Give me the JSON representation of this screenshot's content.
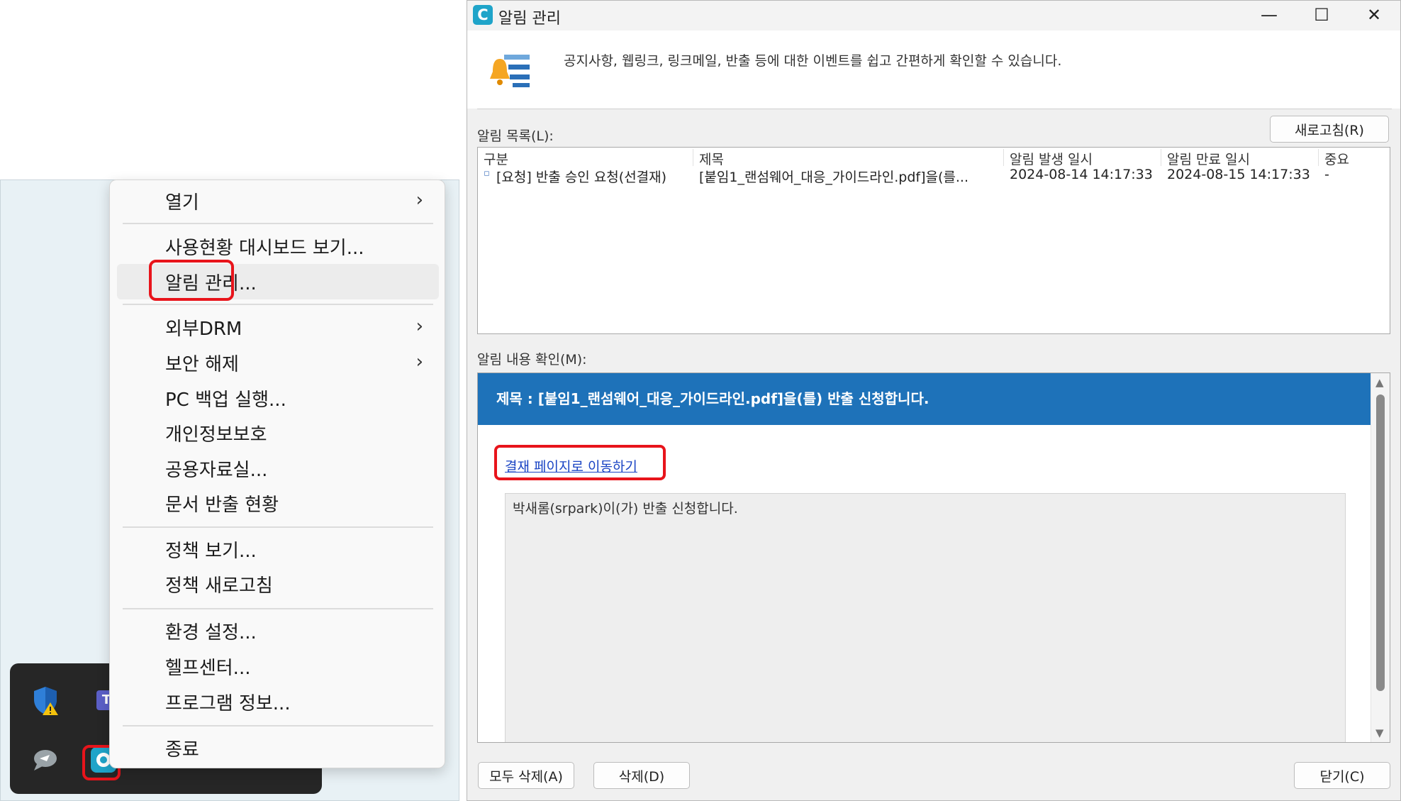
{
  "context_menu": {
    "items": [
      {
        "label": "열기"
      },
      {
        "label": "사용현황 대시보드 보기..."
      },
      {
        "label": "알림 관리..."
      },
      {
        "label": "외부DRM"
      },
      {
        "label": "보안 해제"
      },
      {
        "label": "PC 백업 실행..."
      },
      {
        "label": "개인정보보호"
      },
      {
        "label": "공용자료실..."
      },
      {
        "label": "문서 반출 현황"
      },
      {
        "label": "정책 보기..."
      },
      {
        "label": "정책 새로고침"
      },
      {
        "label": "환경 설정..."
      },
      {
        "label": "헬프센터..."
      },
      {
        "label": "프로그램 정보..."
      },
      {
        "label": "종료"
      }
    ]
  },
  "tray": {
    "teams_label": "T"
  },
  "window": {
    "title": "알림 관리",
    "app_icon_letter": "C",
    "controls": {
      "minimize": "—",
      "maximize": "☐",
      "close": "✕"
    },
    "description": "공지사항, 웹링크, 링크메일, 반출 등에 대한 이벤트를 쉽고 간편하게 확인할 수 있습니다.",
    "refresh_button": "새로고침(R)",
    "list_label": "알림 목록(L):",
    "columns": [
      "구분",
      "제목",
      "알림 발생 일시",
      "알림 만료 일시",
      "중요"
    ],
    "rows": [
      {
        "type": "[요청] 반출 승인 요청(선결재)",
        "title": "[붙임1_랜섬웨어_대응_가이드라인.pdf]을(를...",
        "created": "2024-08-14 14:17:33",
        "expires": "2024-08-15 14:17:33",
        "important": "-"
      }
    ],
    "detail_label": "알림 내용 확인(M):",
    "detail_title": "제목 : [붙임1_랜섬웨어_대응_가이드라인.pdf]을(를) 반출 신청합니다.",
    "approval_link": "결재 페이지로 이동하기",
    "detail_body": "박새롬(srpark)이(가) 반출 신청합니다.",
    "buttons": {
      "delete_all": "모두 삭제(A)",
      "delete": "삭제(D)",
      "close": "닫기(C)"
    }
  },
  "colors": {
    "highlight_red": "#e8141b",
    "title_bar_blue": "#1e72b9",
    "link_blue": "#1a44c4",
    "app_teal": "#1fa4c9"
  }
}
